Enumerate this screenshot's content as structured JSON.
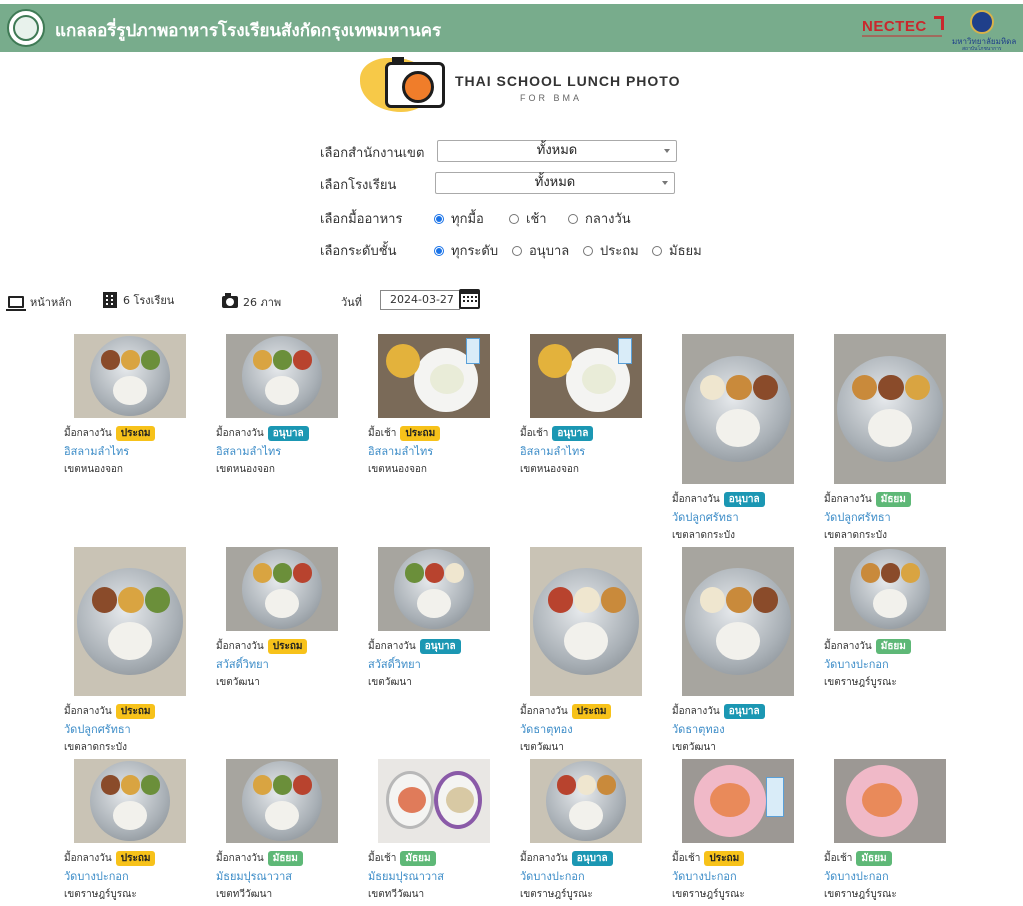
{
  "header": {
    "title": "แกลลอรี่รูปภาพอาหารโรงเรียนสังกัดกรุงเทพมหานคร",
    "partner_left": "NECTEC",
    "partner_right": "มหาวิทยาลัยมหิดล",
    "partner_right_sub": "สถาบันโภชนาการ"
  },
  "brand": {
    "title": "THAI SCHOOL LUNCH PHOTO",
    "subtitle": "FOR BMA"
  },
  "filters": {
    "district": {
      "label": "เลือกสำนักงานเขต",
      "value": "ทั้งหมด"
    },
    "school": {
      "label": "เลือกโรงเรียน",
      "value": "ทั้งหมด"
    },
    "meal": {
      "label": "เลือกมื้ออาหาร",
      "options": [
        "ทุกมื้อ",
        "เช้า",
        "กลางวัน"
      ],
      "selected": "ทุกมื้อ"
    },
    "level": {
      "label": "เลือกระดับชั้น",
      "options": [
        "ทุกระดับ",
        "อนุบาล",
        "ประถม",
        "มัธยม"
      ],
      "selected": "ทุกระดับ"
    }
  },
  "toolbar": {
    "home": "หน้าหลัก",
    "schools": "6 โรงเรียน",
    "photos": "26 ภาพ",
    "date_label": "วันที่",
    "date_value": "2024-03-27"
  },
  "colors": {
    "header_bg": "#78ac8c",
    "link": "#3a8bc7",
    "badge_primary": "#f7c21a",
    "badge_kindergarten": "#1b97b3",
    "badge_secondary": "#5eb877"
  },
  "cards": [
    {
      "meal": "มื้อกลางวัน",
      "level": "ประถม",
      "school": "อิสลามลำไทร",
      "district": "เขตหนองจอก"
    },
    {
      "meal": "มื้อกลางวัน",
      "level": "อนุบาล",
      "school": "อิสลามลำไทร",
      "district": "เขตหนองจอก"
    },
    {
      "meal": "มื้อเช้า",
      "level": "ประถม",
      "school": "อิสลามลำไทร",
      "district": "เขตหนองจอก"
    },
    {
      "meal": "มื้อเช้า",
      "level": "อนุบาล",
      "school": "อิสลามลำไทร",
      "district": "เขตหนองจอก"
    },
    {
      "meal": "มื้อกลางวัน",
      "level": "อนุบาล",
      "school": "วัดปลูกศรัทธา",
      "district": "เขตลาดกระบัง"
    },
    {
      "meal": "มื้อกลางวัน",
      "level": "มัธยม",
      "school": "วัดปลูกศรัทธา",
      "district": "เขตลาดกระบัง"
    },
    {
      "meal": "มื้อกลางวัน",
      "level": "ประถม",
      "school": "วัดปลูกศรัทธา",
      "district": "เขตลาดกระบัง"
    },
    {
      "meal": "มื้อกลางวัน",
      "level": "ประถม",
      "school": "สวัสดิ์วิทยา",
      "district": "เขตวัฒนา"
    },
    {
      "meal": "มื้อกลางวัน",
      "level": "อนุบาล",
      "school": "สวัสดิ์วิทยา",
      "district": "เขตวัฒนา"
    },
    {
      "meal": "มื้อกลางวัน",
      "level": "ประถม",
      "school": "วัดธาตุทอง",
      "district": "เขตวัฒนา"
    },
    {
      "meal": "มื้อกลางวัน",
      "level": "อนุบาล",
      "school": "วัดธาตุทอง",
      "district": "เขตวัฒนา"
    },
    {
      "meal": "มื้อกลางวัน",
      "level": "มัธยม",
      "school": "วัดบางปะกอก",
      "district": "เขตราษฎร์บูรณะ"
    },
    {
      "meal": "มื้อกลางวัน",
      "level": "ประถม",
      "school": "วัดบางปะกอก",
      "district": "เขตราษฎร์บูรณะ"
    },
    {
      "meal": "มื้อกลางวัน",
      "level": "มัธยม",
      "school": "มัธยมปุรณาวาส",
      "district": "เขตทวีวัฒนา"
    },
    {
      "meal": "มื้อเช้า",
      "level": "มัธยม",
      "school": "มัธยมปุรณาวาส",
      "district": "เขตทวีวัฒนา"
    },
    {
      "meal": "มื้อกลางวัน",
      "level": "อนุบาล",
      "school": "วัดบางปะกอก",
      "district": "เขตราษฎร์บูรณะ"
    },
    {
      "meal": "มื้อเช้า",
      "level": "ประถม",
      "school": "วัดบางปะกอก",
      "district": "เขตราษฎร์บูรณะ"
    },
    {
      "meal": "มื้อเช้า",
      "level": "มัธยม",
      "school": "วัดบางปะกอก",
      "district": "เขตราษฎร์บูรณะ"
    }
  ]
}
